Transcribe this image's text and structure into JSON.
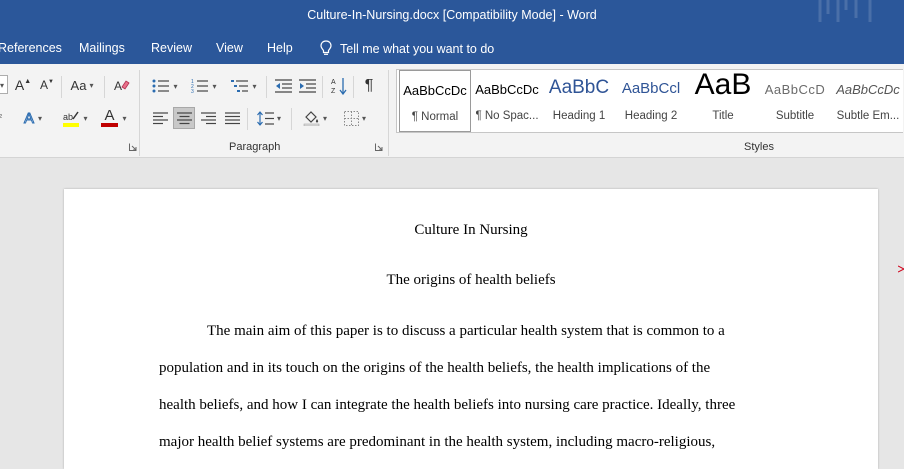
{
  "window": {
    "title": "Culture-In-Nursing.docx [Compatibility Mode]  -  Word"
  },
  "tabs": [
    "References",
    "Mailings",
    "Review",
    "View",
    "Help"
  ],
  "tell_me": "Tell me what you want to do",
  "ribbon": {
    "font_group": {
      "grow_label": "A",
      "shrink_label": "A",
      "case_label": "Aa",
      "font_color_label": "A",
      "effects_label": "A"
    },
    "paragraph_label": "Paragraph",
    "styles_label": "Styles",
    "styles": [
      {
        "preview": "AaBbCcDc",
        "name": "¶ Normal"
      },
      {
        "preview": "AaBbCcDc",
        "name": "¶ No Spac..."
      },
      {
        "preview": "AaBbC",
        "name": "Heading 1"
      },
      {
        "preview": "AaBbCcl",
        "name": "Heading 2"
      },
      {
        "preview": "AaB",
        "name": "Title"
      },
      {
        "preview": "AaBbCcD",
        "name": "Subtitle"
      },
      {
        "preview": "AaBbCcDc",
        "name": "Subtle Em..."
      }
    ]
  },
  "colors": {
    "title_bar": "#2b579a",
    "highlight": "#ffff00",
    "font_color": "#c00000",
    "heading": "#2f5496"
  },
  "document": {
    "title": "Culture In Nursing",
    "heading": "The origins of health beliefs",
    "lines": [
      "The main aim of this paper is to discuss a particular health system that is common to a",
      "population and in its touch on the origins of the health beliefs, the health implications of the",
      "health beliefs, and how I can integrate the health beliefs into nursing care practice. Ideally, three",
      "major health belief systems are predominant in the health system, including macro-religious,"
    ]
  }
}
